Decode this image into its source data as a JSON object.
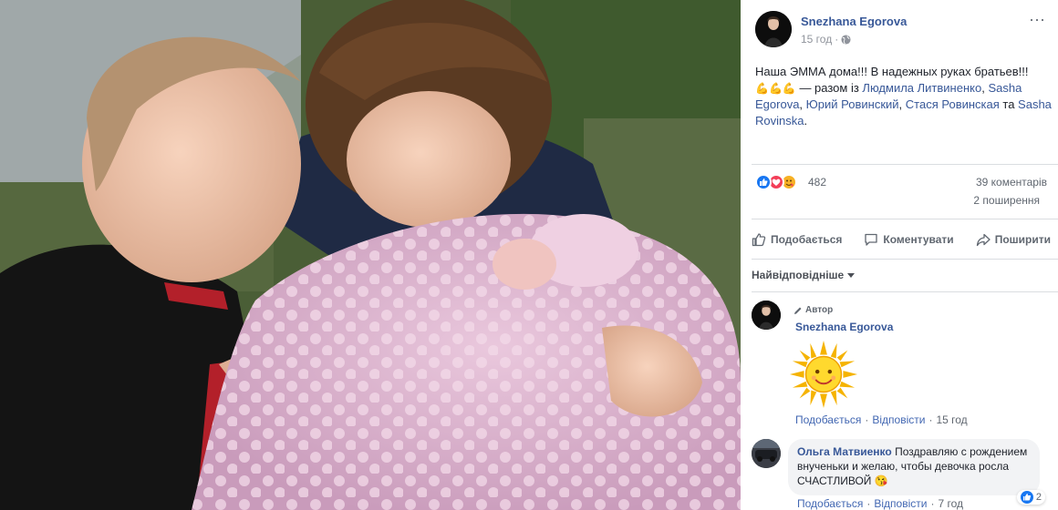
{
  "post": {
    "author": "Snezhana Egorova",
    "time": "15 год",
    "text_line1": "Наша ЭММА дома!!! В надежных руках братьев!!!",
    "with_prefix": " — разом із ",
    "tagged": [
      "Людмила Литвиненко",
      "Sasha Egorova",
      "Юрий Ровинский",
      "Стася Ровинская",
      "Sasha Rovinska"
    ],
    "sep": ", ",
    "and_word": " та ",
    "end": "."
  },
  "stats": {
    "reactions_count": "482",
    "comments": "39 коментарів",
    "shares": "2 поширення"
  },
  "actions": {
    "like": "Подобається",
    "comment": "Коментувати",
    "share": "Поширити"
  },
  "sort_label": "Найвідповідніше",
  "comments": [
    {
      "badge": "Автор",
      "name": "Snezhana Egorova",
      "like": "Подобається",
      "reply": "Відповісти",
      "time": "15 год"
    },
    {
      "name": "Ольга Матвиенко",
      "text": "Поздравляю с рождением внученьки и желаю, чтобы девочка росла СЧАСТЛИВОЙ",
      "like": "Подобається",
      "reply": "Відповісти",
      "time": "7 год",
      "reactions": "2"
    }
  ],
  "dot": "·",
  "icons": {
    "globe": "globe-icon",
    "more": "more-horizontal-icon",
    "like": "thumbs-up-icon",
    "comment": "comment-bubble-icon",
    "share": "share-arrow-icon",
    "pencil": "pencil-icon"
  },
  "colors": {
    "link": "#385898",
    "like_blue": "#1877f2",
    "love_red": "#f33e58",
    "wow_yellow": "#f7b125"
  }
}
